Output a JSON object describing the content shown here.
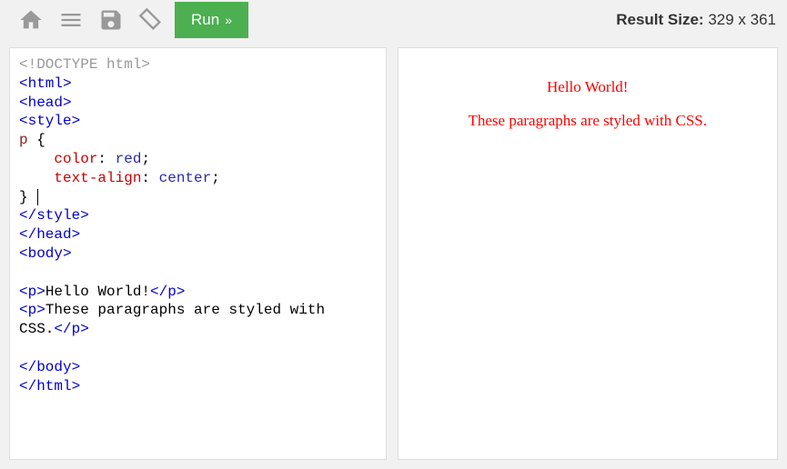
{
  "toolbar": {
    "run_label": "Run"
  },
  "status": {
    "label": "Result Size:",
    "value": "329 x 361"
  },
  "code": {
    "doctype": "<!DOCTYPE html>",
    "tag_html_open": "<html>",
    "tag_head_open": "<head>",
    "tag_style_open": "<style>",
    "selector": "p",
    "brace_open": " {",
    "indent": "    ",
    "prop1": "color",
    "colon": ": ",
    "val1": "red",
    "semicolon": ";",
    "prop2": "text-align",
    "val2": "center",
    "brace_close": "} ",
    "tag_style_close": "</style>",
    "tag_head_close": "</head>",
    "tag_body_open": "<body>",
    "tag_p_open": "<p>",
    "text1": "Hello World!",
    "tag_p_close": "</p>",
    "text2a": "These paragraphs are styled with ",
    "text2b": "CSS.",
    "tag_body_close": "</body>",
    "tag_html_close": "</html>"
  },
  "preview": {
    "p1": "Hello World!",
    "p2": "These paragraphs are styled with CSS."
  }
}
